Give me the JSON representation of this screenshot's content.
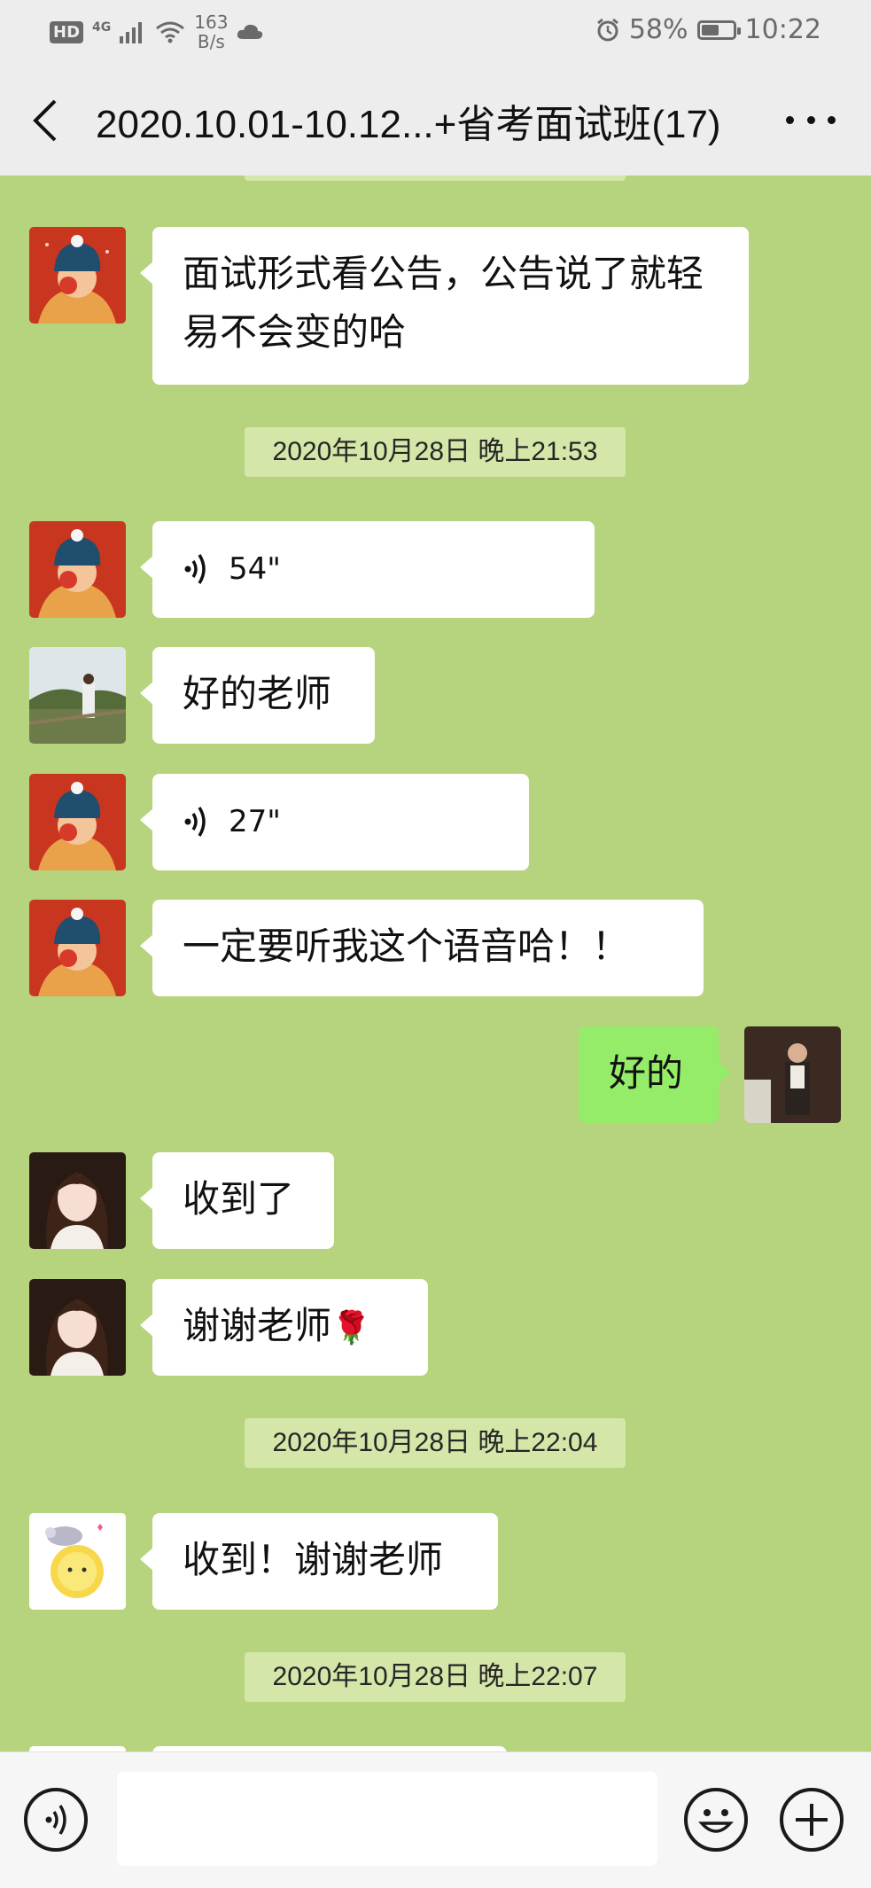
{
  "status_bar": {
    "hd": "HD",
    "network": "4G",
    "speed_value": "163",
    "speed_unit": "B/s",
    "battery_percent": "58%",
    "battery_level": 0.58,
    "time": "10:22",
    "icons": [
      "signal-icon",
      "wifi-icon",
      "cloud-icon",
      "alarm-icon",
      "battery-icon"
    ]
  },
  "header": {
    "title": "2020.10.01-10.12...+省考面试班(17)",
    "icons": [
      "back-arrow-icon",
      "more-icon"
    ]
  },
  "colors": {
    "chat_bg": "#b6d47d",
    "bubble_in": "#ffffff",
    "bubble_out": "#95ec69",
    "stamp_bg": "#d5e6a9"
  },
  "chat": {
    "message_1": "面试形式看公告，公告说了就轻易不会变的哈",
    "timestamp_1": "2020年10月28日 晚上21:53",
    "voice_1": "54\"",
    "message_2": "好的老师",
    "voice_2": "27\"",
    "message_3": "一定要听我这个语音哈！！",
    "message_4_out": "好的",
    "message_5": "收到了",
    "message_6": "谢谢老师",
    "message_6_emoji": "🌹",
    "timestamp_2": "2020年10月28日 晚上22:04",
    "message_7": "收到！谢谢老师",
    "timestamp_3": "2020年10月28日 晚上22:07"
  },
  "input_bar": {
    "icons": [
      "voice-mode-icon",
      "emoji-icon",
      "plus-icon"
    ]
  }
}
